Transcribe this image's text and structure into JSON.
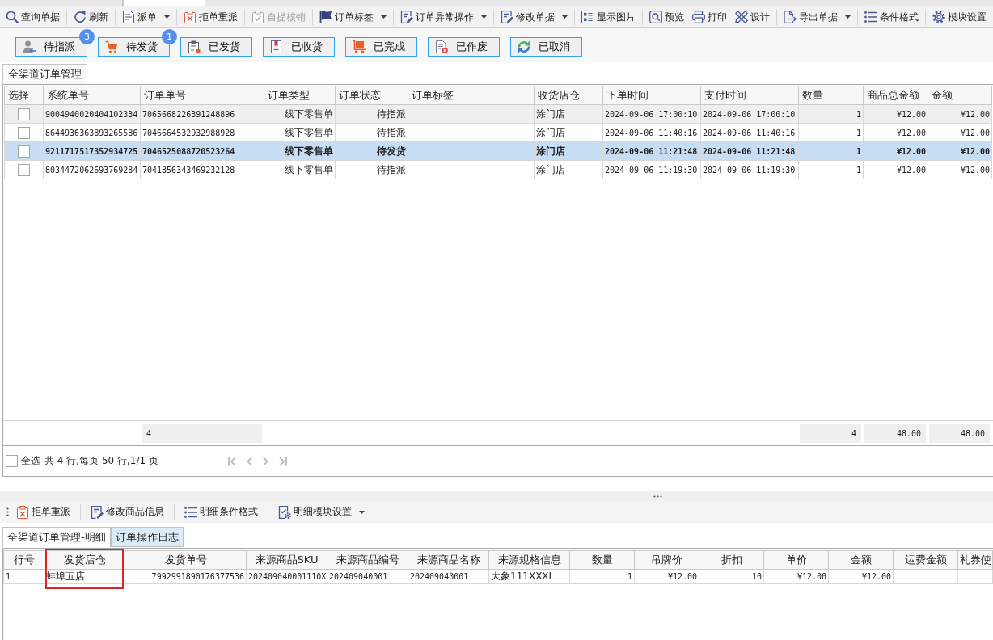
{
  "toolbar": {
    "groups": [
      {
        "items": [
          {
            "label": "查询单据",
            "dropdown": false,
            "disabled": false
          }
        ]
      },
      {
        "items": [
          {
            "label": "刷新",
            "dropdown": false,
            "disabled": false
          }
        ]
      },
      {
        "items": [
          {
            "label": "派单",
            "dropdown": true,
            "disabled": false
          }
        ]
      },
      {
        "items": [
          {
            "label": "拒单重派",
            "dropdown": false,
            "disabled": false
          }
        ]
      },
      {
        "items": [
          {
            "label": "自提核销",
            "dropdown": false,
            "disabled": true
          }
        ]
      },
      {
        "items": [
          {
            "label": "订单标签",
            "dropdown": true,
            "disabled": false
          }
        ]
      },
      {
        "items": [
          {
            "label": "订单异常操作",
            "dropdown": true,
            "disabled": false
          }
        ]
      },
      {
        "items": [
          {
            "label": "修改单据",
            "dropdown": true,
            "disabled": false
          }
        ]
      },
      {
        "items": [
          {
            "label": "显示图片",
            "dropdown": false,
            "disabled": false
          }
        ]
      },
      {
        "items": [
          {
            "label": "预览",
            "dropdown": false,
            "disabled": false
          },
          {
            "label": "打印",
            "dropdown": false,
            "disabled": false
          },
          {
            "label": "设计",
            "dropdown": false,
            "disabled": false
          }
        ]
      },
      {
        "items": [
          {
            "label": "导出单据",
            "dropdown": true,
            "disabled": false
          }
        ]
      },
      {
        "items": [
          {
            "label": "条件格式",
            "dropdown": false,
            "disabled": false
          }
        ]
      },
      {
        "items": [
          {
            "label": "模块设置",
            "dropdown": false,
            "disabled": false
          }
        ]
      }
    ]
  },
  "status_buttons": [
    {
      "label": "待指派",
      "badge": "3"
    },
    {
      "label": "待发货",
      "badge": "1"
    },
    {
      "label": "已发货"
    },
    {
      "label": "已收货"
    },
    {
      "label": "已完成"
    },
    {
      "label": "已作废"
    },
    {
      "label": "已取消"
    }
  ],
  "main_tabs": [
    {
      "label": "全渠道订单管理",
      "selected": true
    }
  ],
  "order_table": {
    "columns": [
      {
        "label": "选择"
      },
      {
        "label": "系统单号"
      },
      {
        "label": "订单单号"
      },
      {
        "label": "订单类型"
      },
      {
        "label": "订单状态"
      },
      {
        "label": "订单标签"
      },
      {
        "label": "收货店仓"
      },
      {
        "label": "下单时间"
      },
      {
        "label": "支付时间"
      },
      {
        "label": "数量"
      },
      {
        "label": "商品总金额"
      },
      {
        "label": "金额"
      }
    ],
    "rows": [
      {
        "checked": false,
        "selected": false,
        "hovered": true,
        "system_no": "9004940020404102334",
        "order_no": "7065668226391248896",
        "order_type": "线下零售单",
        "order_status": "待指派",
        "store": "涂门店",
        "order_time": "2024-09-06 17:00:10",
        "pay_time": "2024-09-06 17:00:10",
        "quantity": "1",
        "goods_total": "¥12.00",
        "amount": "¥12.00"
      },
      {
        "checked": false,
        "selected": false,
        "hovered": false,
        "system_no": "8644936363893265586",
        "order_no": "7046664532932988928",
        "order_type": "线下零售单",
        "order_status": "待指派",
        "store": "涂门店",
        "order_time": "2024-09-06 11:40:16",
        "pay_time": "2024-09-06 11:40:16",
        "quantity": "1",
        "goods_total": "¥12.00",
        "amount": "¥12.00"
      },
      {
        "checked": false,
        "selected": true,
        "hovered": false,
        "system_no": "9211717517352934725",
        "order_no": "7046525088720523264",
        "order_type": "线下零售单",
        "order_status": "待发货",
        "store": "涂门店",
        "order_time": "2024-09-06 11:21:48",
        "pay_time": "2024-09-06 11:21:48",
        "quantity": "1",
        "goods_total": "¥12.00",
        "amount": "¥12.00"
      },
      {
        "checked": false,
        "selected": false,
        "hovered": false,
        "system_no": "8034472062693769284",
        "order_no": "7041856343469232128",
        "order_type": "线下零售单",
        "order_status": "待指派",
        "store": "涂门店",
        "order_time": "2024-09-06 11:19:30",
        "pay_time": "2024-09-06 11:19:30",
        "quantity": "1",
        "goods_total": "¥12.00",
        "amount": "¥12.00"
      }
    ],
    "totals": {
      "order_no": "4",
      "quantity": "4",
      "goods_total": "48.00",
      "amount": "48.00"
    }
  },
  "pagination": {
    "select_all": {
      "label": "全选",
      "checked": false
    },
    "summary": "共 4 行,每页 50 行,1/1 页"
  },
  "detail_toolbar": {
    "items": [
      {
        "label": "拒单重派",
        "dropdown": false
      },
      {
        "label": "修改商品信息",
        "dropdown": false
      },
      {
        "label": "明细条件格式",
        "dropdown": false
      },
      {
        "label": "明细模块设置",
        "dropdown": true
      }
    ]
  },
  "detail_tabs": [
    {
      "label": "全渠道订单管理-明细",
      "selected": true
    },
    {
      "label": "订单操作日志",
      "selected": false
    }
  ],
  "detail_table": {
    "columns": [
      {
        "label": "行号",
        "marked": false
      },
      {
        "label": "发货店仓",
        "marked": true
      },
      {
        "label": "发货单号",
        "marked": false
      },
      {
        "label": "来源商品SKU",
        "marked": false
      },
      {
        "label": "来源商品编号",
        "marked": false
      },
      {
        "label": "来源商品名称",
        "marked": false
      },
      {
        "label": "来源规格信息",
        "marked": false
      },
      {
        "label": "数量",
        "marked": false
      },
      {
        "label": "吊牌价",
        "marked": false
      },
      {
        "label": "折扣",
        "marked": false
      },
      {
        "label": "单价",
        "marked": false
      },
      {
        "label": "金额",
        "marked": false
      },
      {
        "label": "运费金额",
        "marked": false
      },
      {
        "label": "礼券使",
        "marked": false
      }
    ],
    "rows": [
      {
        "line_no": "1",
        "ship_store": "蚌埠五店",
        "ship_no": "7992991890176377536",
        "source_sku": "202409040001110X",
        "source_item_code": "202409040001",
        "source_item_name": "202409040001",
        "source_spec": "大象111XXXL",
        "quantity": "1",
        "tag_price": "¥12.00",
        "discount": "10",
        "unit_price": "¥12.00",
        "amount": "¥12.00"
      }
    ]
  }
}
